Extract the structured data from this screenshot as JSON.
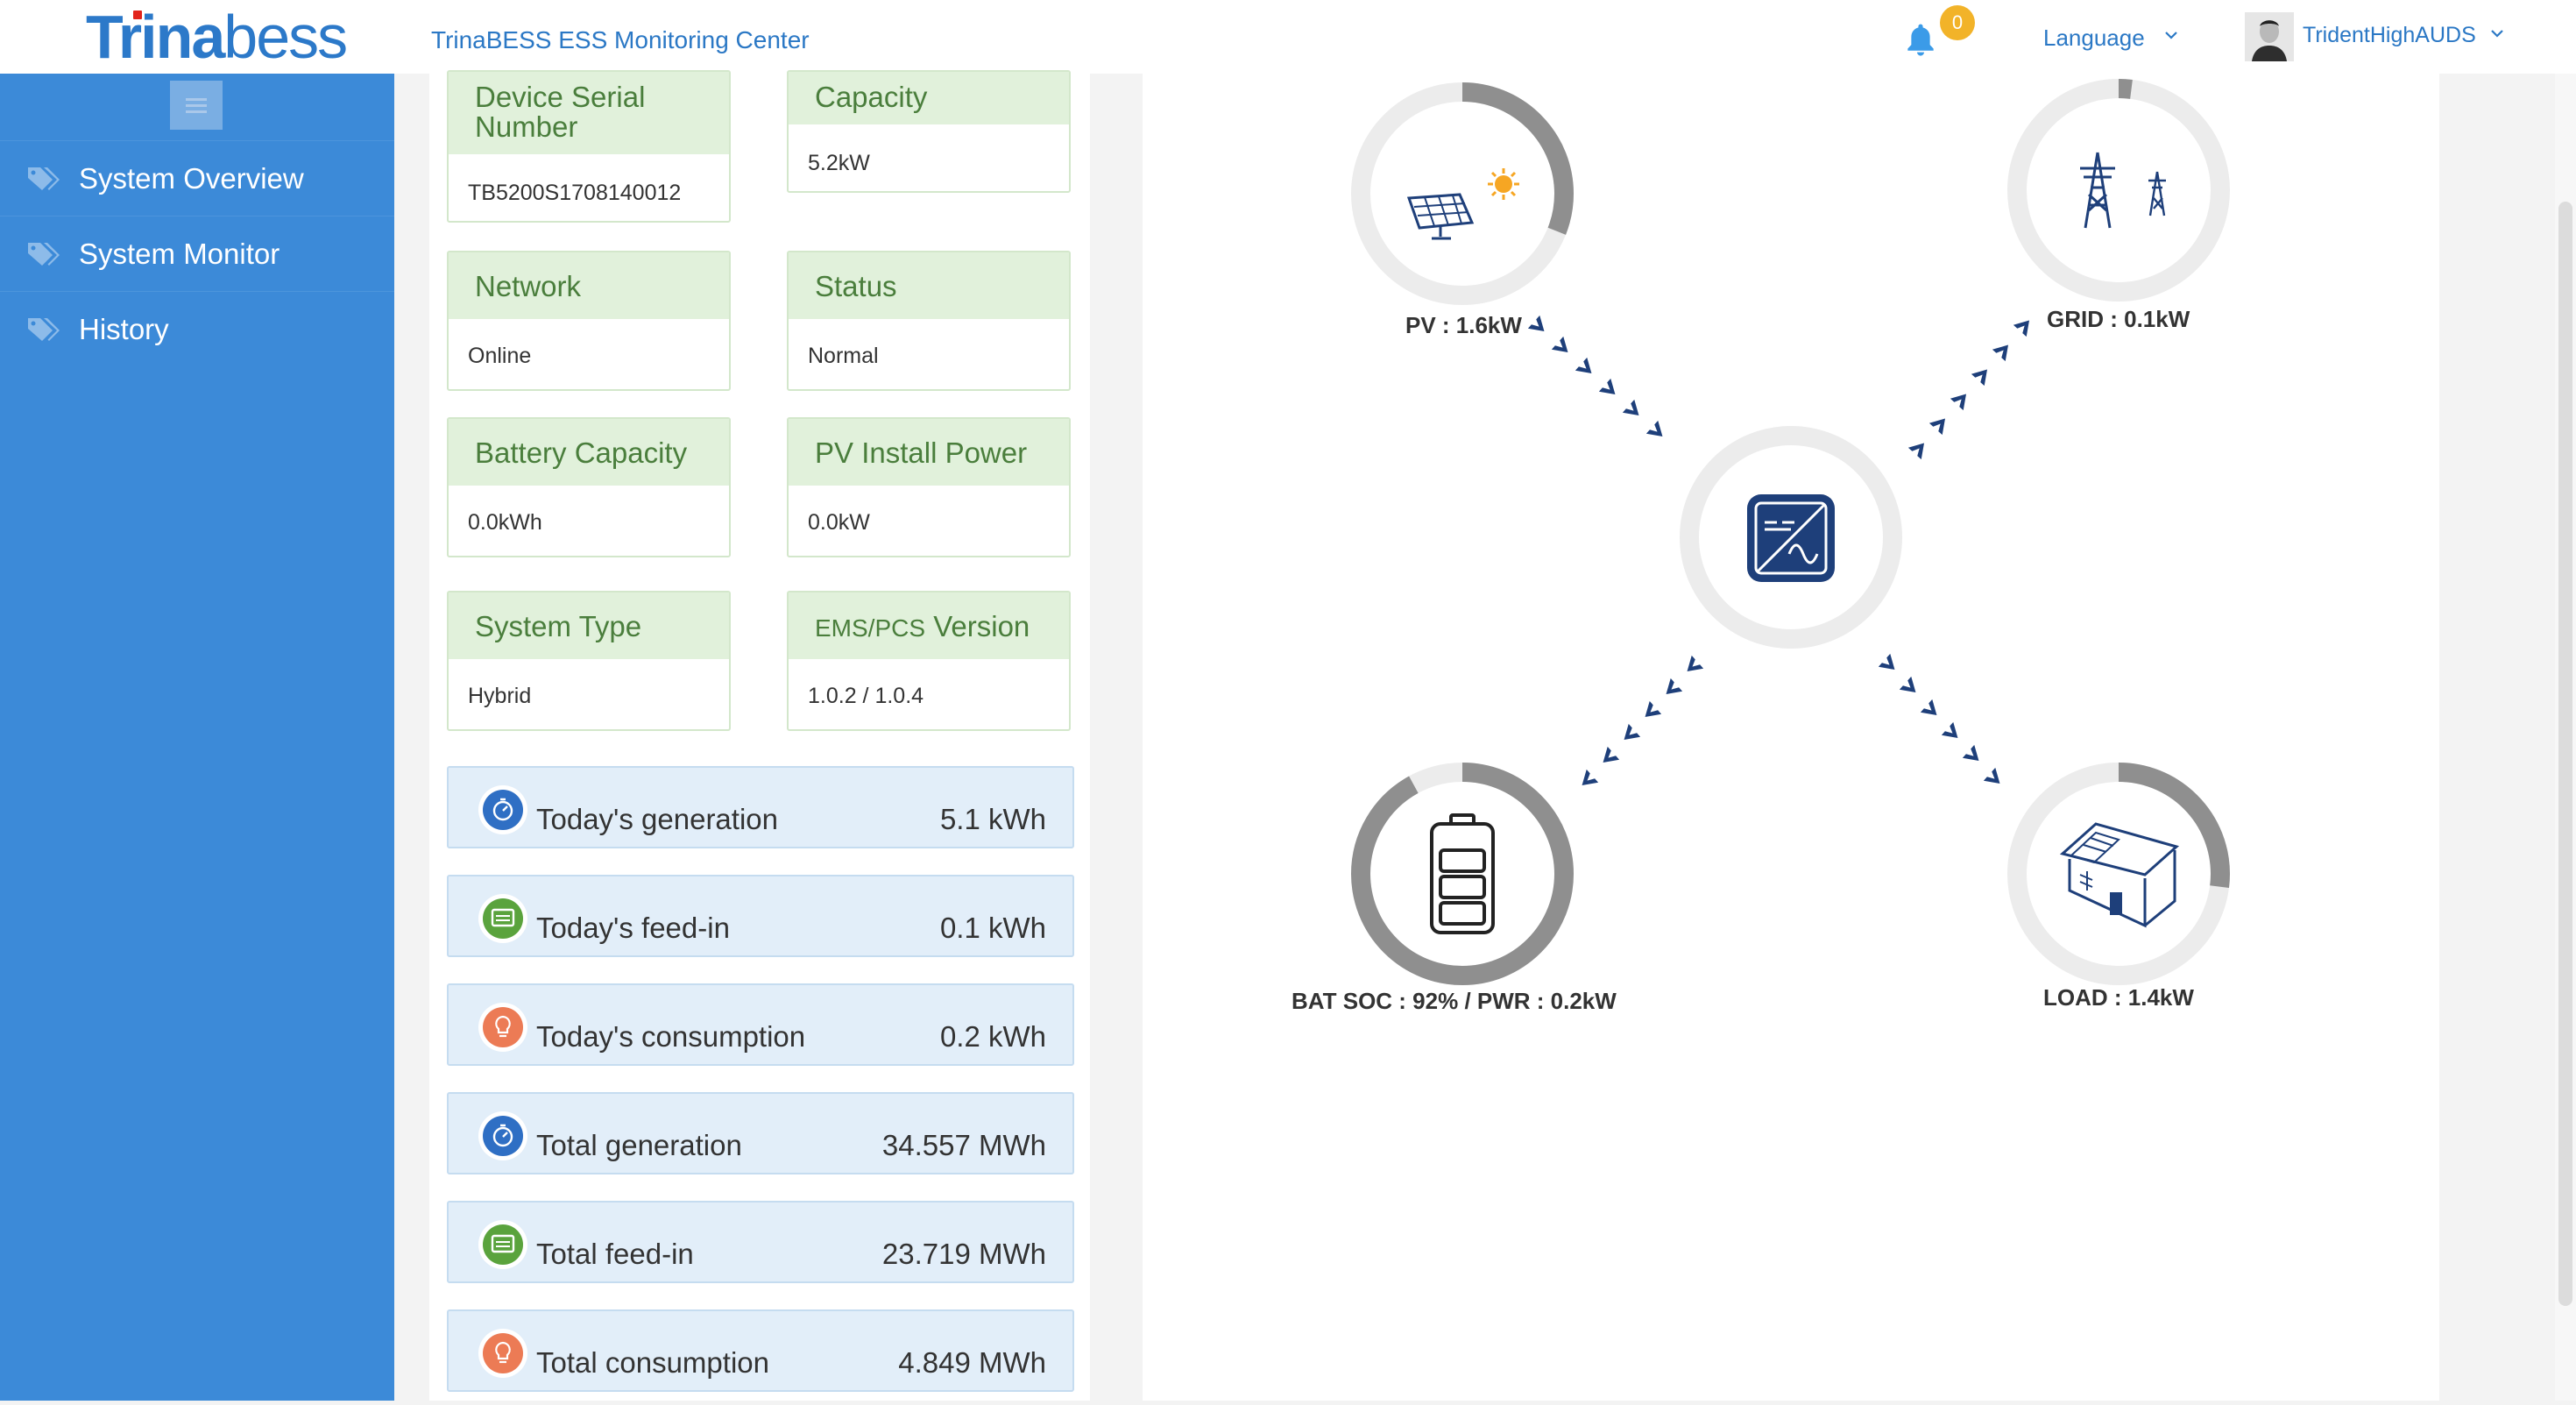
{
  "header": {
    "logo_part1": "Trina",
    "logo_part2": "bess",
    "title": "TrinaBESS ESS Monitoring Center",
    "notification_count": "0",
    "language_label": "Language",
    "username": "TridentHighAUDS"
  },
  "sidebar": {
    "items": [
      {
        "label": "System Overview",
        "icon": "tags-icon"
      },
      {
        "label": "System Monitor",
        "icon": "tags-icon"
      },
      {
        "label": "History",
        "icon": "tags-icon"
      }
    ]
  },
  "info_cards": [
    {
      "label": "Device Serial Number",
      "value": "TB5200S1708140012"
    },
    {
      "label": "Capacity",
      "value": "5.2kW"
    },
    {
      "label": "Network",
      "value": "Online"
    },
    {
      "label": "Status",
      "value": "Normal"
    },
    {
      "label": "Battery Capacity",
      "value": "0.0kWh"
    },
    {
      "label": "PV Install Power",
      "value": "0.0kW"
    },
    {
      "label": "System Type",
      "value": "Hybrid"
    },
    {
      "label_prefix": "EMS/PCS",
      "label_suffix": " Version",
      "value": "1.0.2 / 1.0.4"
    }
  ],
  "stats": [
    {
      "label": "Today's generation",
      "value": "5.1 kWh",
      "icon": "generation-icon",
      "color": "#2f6fc4"
    },
    {
      "label": "Today's feed-in",
      "value": "0.1 kWh",
      "icon": "feed-in-icon",
      "color": "#5aa33d"
    },
    {
      "label": "Today's consumption",
      "value": "0.2 kWh",
      "icon": "bulb-icon",
      "color": "#ec7b55"
    },
    {
      "label": "Total generation",
      "value": "34.557 MWh",
      "icon": "generation-icon",
      "color": "#2f6fc4"
    },
    {
      "label": "Total feed-in",
      "value": "23.719 MWh",
      "icon": "feed-in-icon",
      "color": "#5aa33d"
    },
    {
      "label": "Total consumption",
      "value": "4.849 MWh",
      "icon": "bulb-icon",
      "color": "#ec7b55"
    }
  ],
  "energy_flow": {
    "pv_label": "PV : 1.6kW",
    "grid_label": "GRID : 0.1kW",
    "battery_label": "BAT SOC : 92% / PWR : 0.2kW",
    "load_label": "LOAD : 1.4kW",
    "pv_ring_fraction": 0.31,
    "grid_ring_fraction": 0.02,
    "battery_ring_fraction": 0.92,
    "load_ring_fraction": 0.27
  },
  "colors": {
    "sidebar": "#3c8ad8",
    "accent": "#2b78c5",
    "card_header": "#e1f1db",
    "stat_bg": "#e2eef9",
    "arrow": "#1e3f7a",
    "ring_track": "#ececec",
    "ring_fill": "#8f8f8f"
  }
}
